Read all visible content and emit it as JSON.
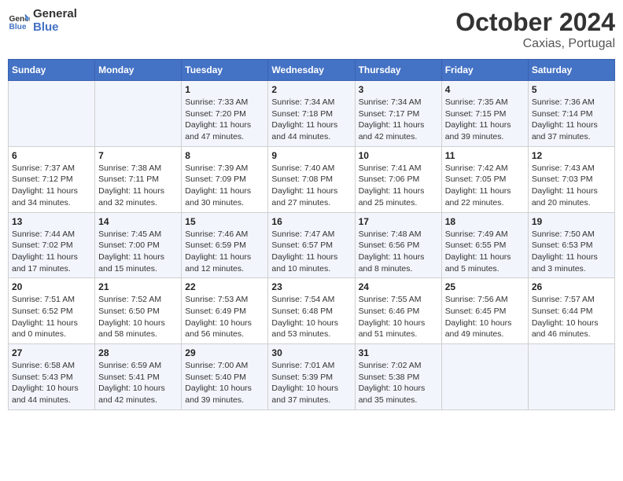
{
  "logo": {
    "general": "General",
    "blue": "Blue"
  },
  "header": {
    "month": "October 2024",
    "location": "Caxias, Portugal"
  },
  "weekdays": [
    "Sunday",
    "Monday",
    "Tuesday",
    "Wednesday",
    "Thursday",
    "Friday",
    "Saturday"
  ],
  "weeks": [
    [
      {
        "day": "",
        "sunrise": "",
        "sunset": "",
        "daylight": ""
      },
      {
        "day": "",
        "sunrise": "",
        "sunset": "",
        "daylight": ""
      },
      {
        "day": "1",
        "sunrise": "Sunrise: 7:33 AM",
        "sunset": "Sunset: 7:20 PM",
        "daylight": "Daylight: 11 hours and 47 minutes."
      },
      {
        "day": "2",
        "sunrise": "Sunrise: 7:34 AM",
        "sunset": "Sunset: 7:18 PM",
        "daylight": "Daylight: 11 hours and 44 minutes."
      },
      {
        "day": "3",
        "sunrise": "Sunrise: 7:34 AM",
        "sunset": "Sunset: 7:17 PM",
        "daylight": "Daylight: 11 hours and 42 minutes."
      },
      {
        "day": "4",
        "sunrise": "Sunrise: 7:35 AM",
        "sunset": "Sunset: 7:15 PM",
        "daylight": "Daylight: 11 hours and 39 minutes."
      },
      {
        "day": "5",
        "sunrise": "Sunrise: 7:36 AM",
        "sunset": "Sunset: 7:14 PM",
        "daylight": "Daylight: 11 hours and 37 minutes."
      }
    ],
    [
      {
        "day": "6",
        "sunrise": "Sunrise: 7:37 AM",
        "sunset": "Sunset: 7:12 PM",
        "daylight": "Daylight: 11 hours and 34 minutes."
      },
      {
        "day": "7",
        "sunrise": "Sunrise: 7:38 AM",
        "sunset": "Sunset: 7:11 PM",
        "daylight": "Daylight: 11 hours and 32 minutes."
      },
      {
        "day": "8",
        "sunrise": "Sunrise: 7:39 AM",
        "sunset": "Sunset: 7:09 PM",
        "daylight": "Daylight: 11 hours and 30 minutes."
      },
      {
        "day": "9",
        "sunrise": "Sunrise: 7:40 AM",
        "sunset": "Sunset: 7:08 PM",
        "daylight": "Daylight: 11 hours and 27 minutes."
      },
      {
        "day": "10",
        "sunrise": "Sunrise: 7:41 AM",
        "sunset": "Sunset: 7:06 PM",
        "daylight": "Daylight: 11 hours and 25 minutes."
      },
      {
        "day": "11",
        "sunrise": "Sunrise: 7:42 AM",
        "sunset": "Sunset: 7:05 PM",
        "daylight": "Daylight: 11 hours and 22 minutes."
      },
      {
        "day": "12",
        "sunrise": "Sunrise: 7:43 AM",
        "sunset": "Sunset: 7:03 PM",
        "daylight": "Daylight: 11 hours and 20 minutes."
      }
    ],
    [
      {
        "day": "13",
        "sunrise": "Sunrise: 7:44 AM",
        "sunset": "Sunset: 7:02 PM",
        "daylight": "Daylight: 11 hours and 17 minutes."
      },
      {
        "day": "14",
        "sunrise": "Sunrise: 7:45 AM",
        "sunset": "Sunset: 7:00 PM",
        "daylight": "Daylight: 11 hours and 15 minutes."
      },
      {
        "day": "15",
        "sunrise": "Sunrise: 7:46 AM",
        "sunset": "Sunset: 6:59 PM",
        "daylight": "Daylight: 11 hours and 12 minutes."
      },
      {
        "day": "16",
        "sunrise": "Sunrise: 7:47 AM",
        "sunset": "Sunset: 6:57 PM",
        "daylight": "Daylight: 11 hours and 10 minutes."
      },
      {
        "day": "17",
        "sunrise": "Sunrise: 7:48 AM",
        "sunset": "Sunset: 6:56 PM",
        "daylight": "Daylight: 11 hours and 8 minutes."
      },
      {
        "day": "18",
        "sunrise": "Sunrise: 7:49 AM",
        "sunset": "Sunset: 6:55 PM",
        "daylight": "Daylight: 11 hours and 5 minutes."
      },
      {
        "day": "19",
        "sunrise": "Sunrise: 7:50 AM",
        "sunset": "Sunset: 6:53 PM",
        "daylight": "Daylight: 11 hours and 3 minutes."
      }
    ],
    [
      {
        "day": "20",
        "sunrise": "Sunrise: 7:51 AM",
        "sunset": "Sunset: 6:52 PM",
        "daylight": "Daylight: 11 hours and 0 minutes."
      },
      {
        "day": "21",
        "sunrise": "Sunrise: 7:52 AM",
        "sunset": "Sunset: 6:50 PM",
        "daylight": "Daylight: 10 hours and 58 minutes."
      },
      {
        "day": "22",
        "sunrise": "Sunrise: 7:53 AM",
        "sunset": "Sunset: 6:49 PM",
        "daylight": "Daylight: 10 hours and 56 minutes."
      },
      {
        "day": "23",
        "sunrise": "Sunrise: 7:54 AM",
        "sunset": "Sunset: 6:48 PM",
        "daylight": "Daylight: 10 hours and 53 minutes."
      },
      {
        "day": "24",
        "sunrise": "Sunrise: 7:55 AM",
        "sunset": "Sunset: 6:46 PM",
        "daylight": "Daylight: 10 hours and 51 minutes."
      },
      {
        "day": "25",
        "sunrise": "Sunrise: 7:56 AM",
        "sunset": "Sunset: 6:45 PM",
        "daylight": "Daylight: 10 hours and 49 minutes."
      },
      {
        "day": "26",
        "sunrise": "Sunrise: 7:57 AM",
        "sunset": "Sunset: 6:44 PM",
        "daylight": "Daylight: 10 hours and 46 minutes."
      }
    ],
    [
      {
        "day": "27",
        "sunrise": "Sunrise: 6:58 AM",
        "sunset": "Sunset: 5:43 PM",
        "daylight": "Daylight: 10 hours and 44 minutes."
      },
      {
        "day": "28",
        "sunrise": "Sunrise: 6:59 AM",
        "sunset": "Sunset: 5:41 PM",
        "daylight": "Daylight: 10 hours and 42 minutes."
      },
      {
        "day": "29",
        "sunrise": "Sunrise: 7:00 AM",
        "sunset": "Sunset: 5:40 PM",
        "daylight": "Daylight: 10 hours and 39 minutes."
      },
      {
        "day": "30",
        "sunrise": "Sunrise: 7:01 AM",
        "sunset": "Sunset: 5:39 PM",
        "daylight": "Daylight: 10 hours and 37 minutes."
      },
      {
        "day": "31",
        "sunrise": "Sunrise: 7:02 AM",
        "sunset": "Sunset: 5:38 PM",
        "daylight": "Daylight: 10 hours and 35 minutes."
      },
      {
        "day": "",
        "sunrise": "",
        "sunset": "",
        "daylight": ""
      },
      {
        "day": "",
        "sunrise": "",
        "sunset": "",
        "daylight": ""
      }
    ]
  ]
}
